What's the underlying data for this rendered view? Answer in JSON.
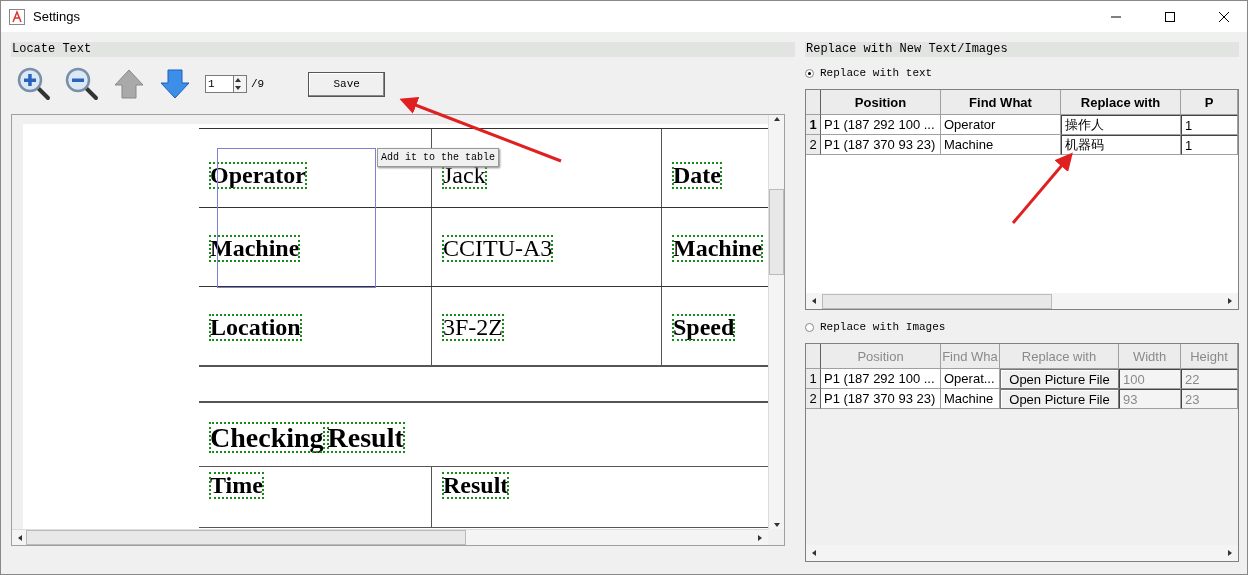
{
  "window": {
    "title": "Settings"
  },
  "locate_panel": {
    "title": "Locate Text",
    "page_field": {
      "value": "1"
    },
    "page_count": "/9",
    "save_button": "Save",
    "tooltip": "Add it to the table",
    "document": {
      "rows": [
        {
          "kind": "row",
          "cells": [
            {
              "words": [
                "Operator"
              ],
              "bold": true
            },
            {
              "words": [
                "Jack"
              ],
              "bold": false
            },
            {
              "words": [
                "Date"
              ],
              "bold": true
            }
          ]
        },
        {
          "kind": "row",
          "cells": [
            {
              "words": [
                "Machine"
              ],
              "bold": true
            },
            {
              "words": [
                "CCITU-A3"
              ],
              "bold": false
            },
            {
              "words": [
                "Machine"
              ],
              "bold": true
            }
          ]
        },
        {
          "kind": "row",
          "cells": [
            {
              "words": [
                "Location"
              ],
              "bold": true
            },
            {
              "words": [
                "3F-2Z"
              ],
              "bold": false
            },
            {
              "words": [
                "Speed"
              ],
              "bold": true
            }
          ]
        },
        {
          "kind": "spacer",
          "cells": []
        },
        {
          "kind": "heading",
          "cells": [
            {
              "words": [
                "Checking",
                "Result"
              ],
              "bold": true
            }
          ]
        },
        {
          "kind": "footer",
          "cells": [
            {
              "words": [
                "Time"
              ],
              "bold": true
            },
            {
              "words": [
                "Result"
              ],
              "bold": true
            }
          ]
        }
      ]
    }
  },
  "replace_panel": {
    "title": "Replace with New Text/Images",
    "options": [
      {
        "kind": "text",
        "label": "Replace with text",
        "selected": true,
        "table": {
          "disabled": false,
          "columns": [
            "Position",
            "Find What",
            "Replace with",
            "P"
          ],
          "rows": [
            {
              "index": "1",
              "selected": true,
              "cells": [
                "P1 (187 292 100 ...",
                "Operator",
                "操作人",
                "1"
              ]
            },
            {
              "index": "2",
              "selected": false,
              "cells": [
                "P1 (187 370 93 23)",
                "Machine",
                "机器码",
                "1"
              ]
            }
          ]
        }
      },
      {
        "kind": "images",
        "label": "Replace with Images",
        "selected": false,
        "table": {
          "disabled": true,
          "columns": [
            "Position",
            "Find Wha",
            "Replace with",
            "Width",
            "Height"
          ],
          "rows": [
            {
              "index": "1",
              "selected": false,
              "cells": [
                "P1 (187 292 100 ...",
                "Operat...",
                "Open Picture File",
                "100",
                "22"
              ]
            },
            {
              "index": "2",
              "selected": false,
              "cells": [
                "P1 (187 370 93 23)",
                "Machine",
                "Open Picture File",
                "93",
                "23"
              ]
            }
          ]
        }
      }
    ]
  }
}
